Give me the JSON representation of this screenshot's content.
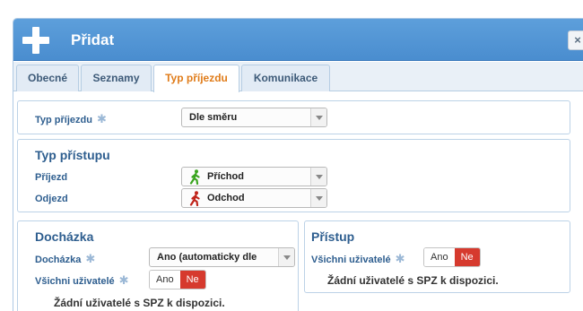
{
  "dialog": {
    "title": "Přidat",
    "close_label": "×"
  },
  "tabs": [
    {
      "label": "Obecné",
      "active": false
    },
    {
      "label": "Seznamy",
      "active": false
    },
    {
      "label": "Typ příjezdu",
      "active": true
    },
    {
      "label": "Komunikace",
      "active": false
    }
  ],
  "arrival_type": {
    "label": "Typ příjezdu",
    "required_mark": "✱",
    "value": "Dle směru"
  },
  "access_type": {
    "title": "Typ přístupu",
    "arrival": {
      "label": "Příjezd",
      "value": "Příchod",
      "icon": "walk-in-icon",
      "icon_color": "#3aa51f"
    },
    "departure": {
      "label": "Odjezd",
      "value": "Odchod",
      "icon": "walk-out-icon",
      "icon_color": "#c0241b"
    }
  },
  "attendance": {
    "title": "Docházka",
    "field_label": "Docházka",
    "required_mark": "✱",
    "value": "Ano (automaticky dle",
    "all_users_label": "Všichni uživatelé",
    "all_users_required_mark": "✱",
    "toggle_yes": "Ano",
    "toggle_no": "Ne",
    "note": "Žádní uživatelé s SPZ k dispozici."
  },
  "access": {
    "title": "Přístup",
    "all_users_label": "Všichni uživatelé",
    "all_users_required_mark": "✱",
    "toggle_yes": "Ano",
    "toggle_no": "Ne",
    "note": "Žádní uživatelé s SPZ k dispozici."
  },
  "colors": {
    "titlebar": "#4a8dcf",
    "active_tab_text": "#e07c1a",
    "section_text": "#2e5e8f",
    "toggle_active": "#d63a2e"
  }
}
